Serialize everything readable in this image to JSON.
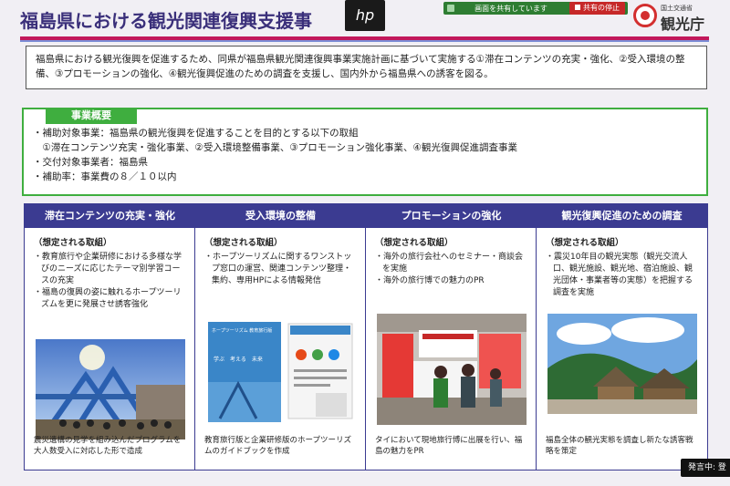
{
  "header": {
    "title": "福島県における観光関連復興支援事",
    "hp_logo": "hp",
    "share_status": "画面を共有しています",
    "stop_share": "共有の停止",
    "ministry_small": "国土交通省",
    "ministry_name": "観光庁"
  },
  "intro": {
    "text": "福島県における観光復興を促進するため、同県が福島県観光関連復興事業実施計画に基づいて実施する①滞在コンテンツの充実・強化、②受入環境の整備、③プロモーションの強化、④観光復興促進のための調査を支援し、国内外から福島県への誘客を図る。"
  },
  "overview": {
    "label": "事業概要",
    "lines": [
      "・補助対象事業：福島県の観光復興を促進することを目的とする以下の取組",
      "　①滞在コンテンツ充実・強化事業、②受入環境整備事業、③プロモーション強化事業、④観光復興促進調査事業",
      "・交付対象事業者：福島県",
      "・補助率：事業費の８／１０以内"
    ]
  },
  "columns": [
    {
      "header": "滞在コンテンツの充実・強化",
      "sub": "（想定される取組）",
      "items": [
        "・教育旅行や企業研修における多様な学びのニーズに応じたテーマ別学習コースの充実",
        "・福島の復興の姿に触れるホープツーリズムを更に発展させ誘客強化"
      ],
      "caption": "震災遺構の見学を組み込んだプログラムを大人数受入に対応した形で造成"
    },
    {
      "header": "受入環境の整備",
      "sub": "（想定される取組）",
      "items": [
        "・ホープツーリズムに関するワンストップ窓口の運営、関連コンテンツ整理・集約、専用HPによる情報発信"
      ],
      "caption": "教育旅行版と企業研修版のホープツーリズムのガイドブックを作成",
      "booklet_title": "ホープツーリズム 教育旅行版",
      "booklet_sub": "学ぶ　考える　未来"
    },
    {
      "header": "プロモーションの強化",
      "sub": "（想定される取組）",
      "items": [
        "・海外の旅行会社へのセミナー・商談会を実施",
        "・海外の旅行博での魅力のPR"
      ],
      "caption": "タイにおいて現地旅行博に出展を行い、福島の魅力をPR"
    },
    {
      "header": "観光復興促進のための調査",
      "sub": "（想定される取組）",
      "items": [
        "・震災10年目の観光実態（観光交流人口、観光施設、観光地、宿泊施設、観光団体・事業者等の実態）を把握する調査を実施"
      ],
      "caption": "福島全体の観光実態を調査し新たな誘客戦略を策定"
    }
  ],
  "footer": {
    "speaking": "発言中: 登"
  },
  "colors": {
    "title": "#3a2f7a",
    "stripe": "#c2185b",
    "column_header": "#3b3b91",
    "overview_green": "#3fae3f"
  }
}
